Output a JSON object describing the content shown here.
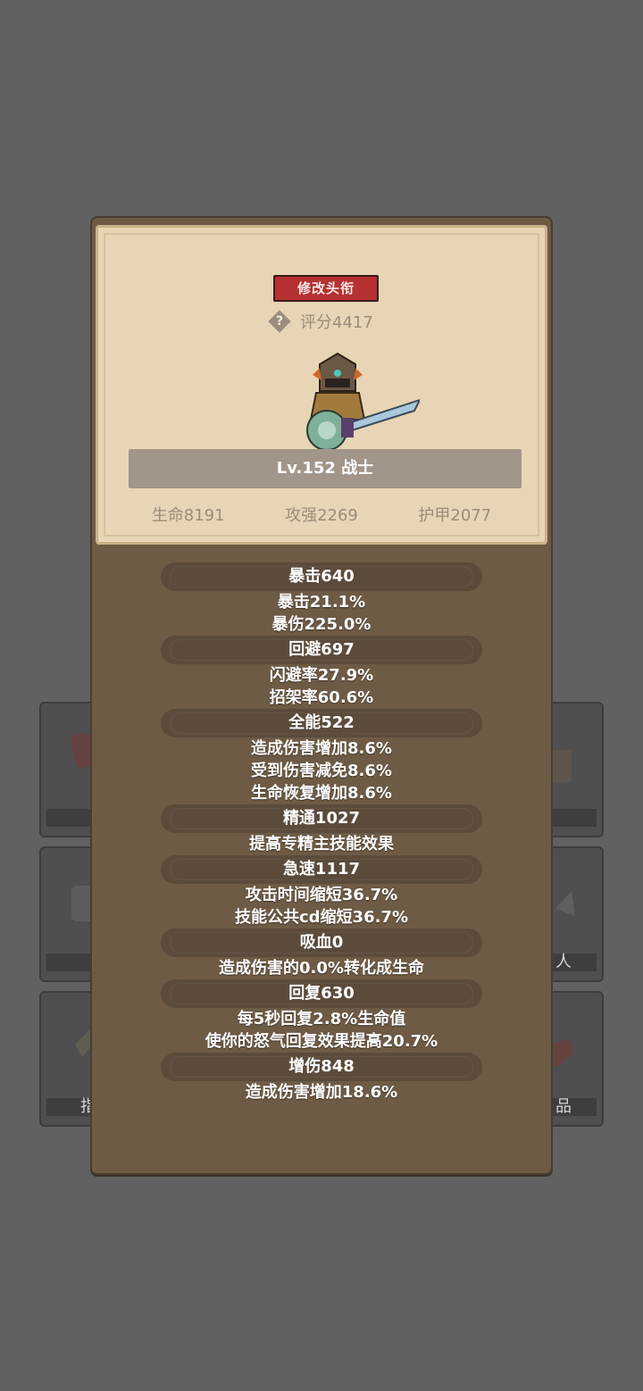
{
  "background_slots": {
    "right_middle_label": "人",
    "left_bottom_label": "指",
    "right_bottom_label": "品"
  },
  "top_card": {
    "title_button": "修改头衔",
    "score_label": "评分4417",
    "level_banner": "Lv.152 战士",
    "basic_stats": [
      "生命8191",
      "攻强2269",
      "护甲2077"
    ]
  },
  "stats": [
    {
      "header": "暴击640",
      "details": [
        "暴击21.1%",
        "暴伤225.0%"
      ]
    },
    {
      "header": "回避697",
      "details": [
        "闪避率27.9%",
        "招架率60.6%"
      ]
    },
    {
      "header": "全能522",
      "details": [
        "造成伤害增加8.6%",
        "受到伤害减免8.6%",
        "生命恢复增加8.6%"
      ]
    },
    {
      "header": "精通1027",
      "details": [
        "提高专精主技能效果"
      ]
    },
    {
      "header": "急速1117",
      "details": [
        "攻击时间缩短36.7%",
        "技能公共cd缩短36.7%"
      ]
    },
    {
      "header": "吸血0",
      "details": [
        "造成伤害的0.0%转化成生命"
      ]
    },
    {
      "header": "回复630",
      "details": [
        "每5秒回复2.8%生命值",
        "使你的怒气回复效果提高20.7%"
      ]
    },
    {
      "header": "增伤848",
      "details": [
        "造成伤害增加18.6%"
      ]
    }
  ],
  "colors": {
    "background": "#616161",
    "panel": "#6e5b45",
    "card": "#e7d5b5",
    "title_button": "#b63131",
    "stat_header": "#5b4b3b"
  }
}
